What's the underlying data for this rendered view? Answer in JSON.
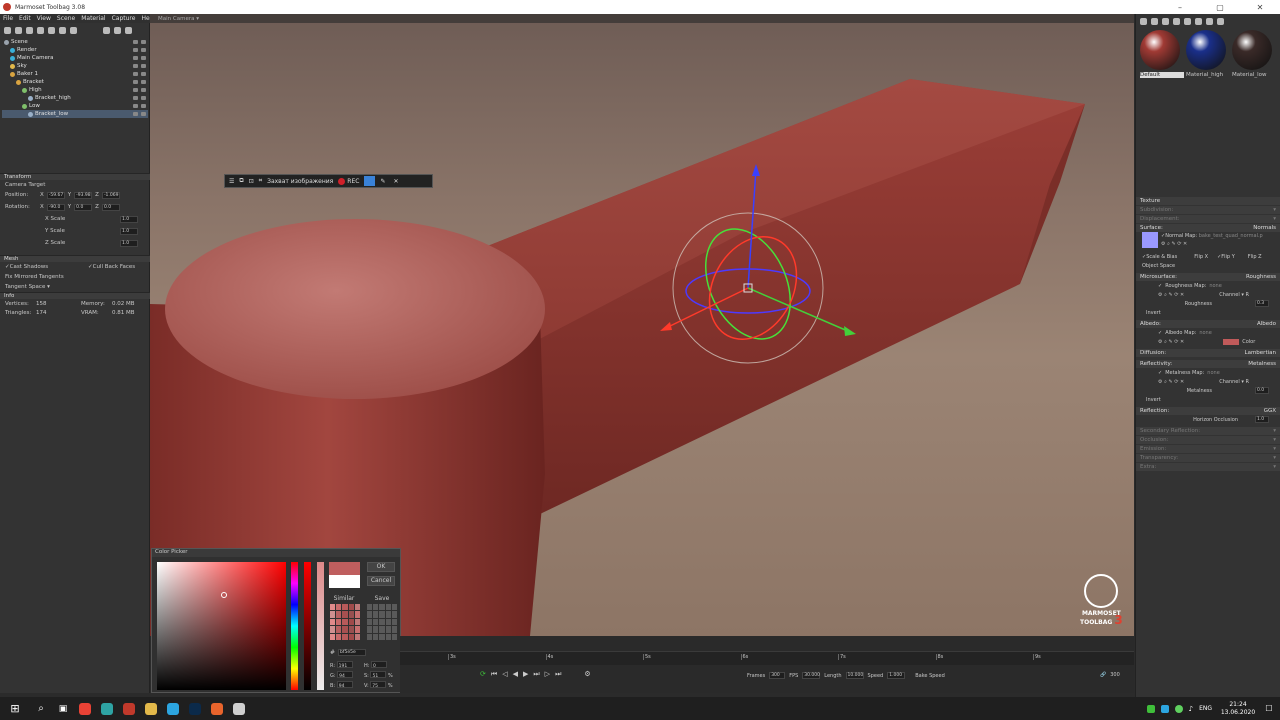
{
  "window": {
    "title": "Marmoset Toolbag 3.08"
  },
  "menu": [
    "File",
    "Edit",
    "View",
    "Scene",
    "Material",
    "Capture",
    "Help"
  ],
  "scene_tree": [
    {
      "label": "Scene",
      "depth": 0,
      "color": "#9aa3ad"
    },
    {
      "label": "Render",
      "depth": 1,
      "color": "#3ab0d8"
    },
    {
      "label": "Main Camera",
      "depth": 1,
      "color": "#3ab0d8"
    },
    {
      "label": "Sky",
      "depth": 1,
      "color": "#e2b84a"
    },
    {
      "label": "Baker 1",
      "depth": 1,
      "color": "#d9a441"
    },
    {
      "label": "Bracket",
      "depth": 2,
      "color": "#d9a441"
    },
    {
      "label": "High",
      "depth": 3,
      "color": "#7fbf6a"
    },
    {
      "label": "Bracket_high",
      "depth": 4,
      "color": "#9ab0c8"
    },
    {
      "label": "Low",
      "depth": 3,
      "color": "#7fbf6a"
    },
    {
      "label": "Bracket_low",
      "depth": 4,
      "color": "#9ab0c8",
      "selected": true
    }
  ],
  "transform": {
    "header": "Transform",
    "camera_target": "Camera Target",
    "position_label": "Position:",
    "position": {
      "x": "-59.67",
      "y": "-93.98",
      "z": "-1.069"
    },
    "rotation_label": "Rotation:",
    "rotation": {
      "x": "-90.0",
      "y": "0.0",
      "z": "0.0"
    },
    "xscale_label": "X Scale",
    "xscale": "1.0",
    "yscale_label": "Y Scale",
    "yscale": "1.0",
    "zscale_label": "Z Scale",
    "zscale": "1.0"
  },
  "mesh": {
    "header": "Mesh",
    "cast_shadows": "Cast Shadows",
    "cull_back_faces": "Cull Back Faces",
    "fix_mirrored": "Fix Mirrored Tangents",
    "tangent_space": "Tangent Space"
  },
  "info": {
    "header": "Info",
    "vertices_label": "Vertices:",
    "vertices": "158",
    "memory_label": "Memory:",
    "memory": "0.02 MB",
    "triangles_label": "Triangles:",
    "triangles": "174",
    "vram_label": "VRAM:",
    "vram": "0.81 MB"
  },
  "viewport": {
    "camera": "Main Camera"
  },
  "capture_bar": {
    "label": "Захват изображения",
    "rec": "REC"
  },
  "materials": [
    {
      "name": "Default",
      "color": "#a03a34",
      "selected": true
    },
    {
      "name": "Material_high",
      "color": "#1a2f8a"
    },
    {
      "name": "Material_low",
      "color": "#3a2a28"
    }
  ],
  "material_props": {
    "texture": "Texture",
    "subdivision": "Subdivision:",
    "displacement": "Displacement:",
    "surface": "Surface:",
    "surface_val": "Normals",
    "normal_map_label": "Normal Map:",
    "normal_map": "bake_test_quad_normal.p",
    "scale_bias": "Scale & Bias",
    "flip_x": "Flip X",
    "flip_y": "Flip Y",
    "flip_z": "Flip Z",
    "object_space": "Object Space",
    "microsurface": "Microsurface:",
    "microsurface_val": "Roughness",
    "roughness_map_label": "Roughness Map:",
    "roughness_map": "none",
    "channel": "Channel",
    "channel_r": "R",
    "roughness": "Roughness",
    "roughness_val": "0.3",
    "invert": "Invert",
    "albedo": "Albedo:",
    "albedo_val": "Albedo",
    "albedo_map_label": "Albedo Map:",
    "albedo_map": "none",
    "color": "Color",
    "albedo_color": "#c05a5a",
    "diffusion": "Diffusion:",
    "diffusion_val": "Lambertian",
    "reflectivity": "Reflectivity:",
    "reflectivity_val": "Metalness",
    "metalness_map_label": "Metalness Map:",
    "metalness_map": "none",
    "metalness": "Metalness",
    "metalness_val": "0.0",
    "reflection": "Reflection:",
    "reflection_val": "GGX",
    "horizon_occlusion": "Horizon Occlusion",
    "horizon_val": "1.0",
    "secondary_reflection": "Secondary Reflection:",
    "occlusion": "Occlusion:",
    "emission": "Emission:",
    "transparency": "Transparency:",
    "extra": "Extra:"
  },
  "color_picker": {
    "title": "Color Picker",
    "ok": "OK",
    "cancel": "Cancel",
    "similar": "Similar",
    "save": "Save",
    "hex": "bf5e5e",
    "r": "191",
    "g": "94",
    "b": "94",
    "h": "0",
    "s": "51",
    "v": "75",
    "pct": "%",
    "r_label": "R:",
    "g_label": "G:",
    "b_label": "B:",
    "h_label": "H:",
    "s_label": "S:",
    "v_label": "V:",
    "current": "#bf5e5e",
    "previous": "#ffffff"
  },
  "timeline": {
    "ticks": [
      "3s",
      "4s",
      "5s",
      "6s",
      "7s",
      "8s",
      "9s"
    ],
    "frames_label": "Frames",
    "frames": "300",
    "fps_label": "FPS",
    "fps": "30.000",
    "length_label": "Length",
    "length": "10.000",
    "speed_label": "Speed",
    "speed": "1.000",
    "bake_speed": "Bake Speed",
    "end_frame": "300"
  },
  "logo": {
    "line1": "MARMOSET",
    "line2": "TOOLBAG",
    "num": "3"
  },
  "taskbar": {
    "lang": "ENG",
    "time": "21:24",
    "date": "13.06.2020",
    "apps": [
      {
        "name": "chrome-icon",
        "color": "#e94235"
      },
      {
        "name": "toolbag-icon",
        "color": "#2ea3a3"
      },
      {
        "name": "record-icon",
        "color": "#c0392b"
      },
      {
        "name": "explorer-icon",
        "color": "#e2b84a"
      },
      {
        "name": "telegram-icon",
        "color": "#2ca5e0"
      },
      {
        "name": "photoshop-icon",
        "color": "#0b2a4a"
      },
      {
        "name": "app-icon",
        "color": "#e8642c"
      },
      {
        "name": "steam-icon",
        "color": "#cfcfcf"
      }
    ]
  }
}
